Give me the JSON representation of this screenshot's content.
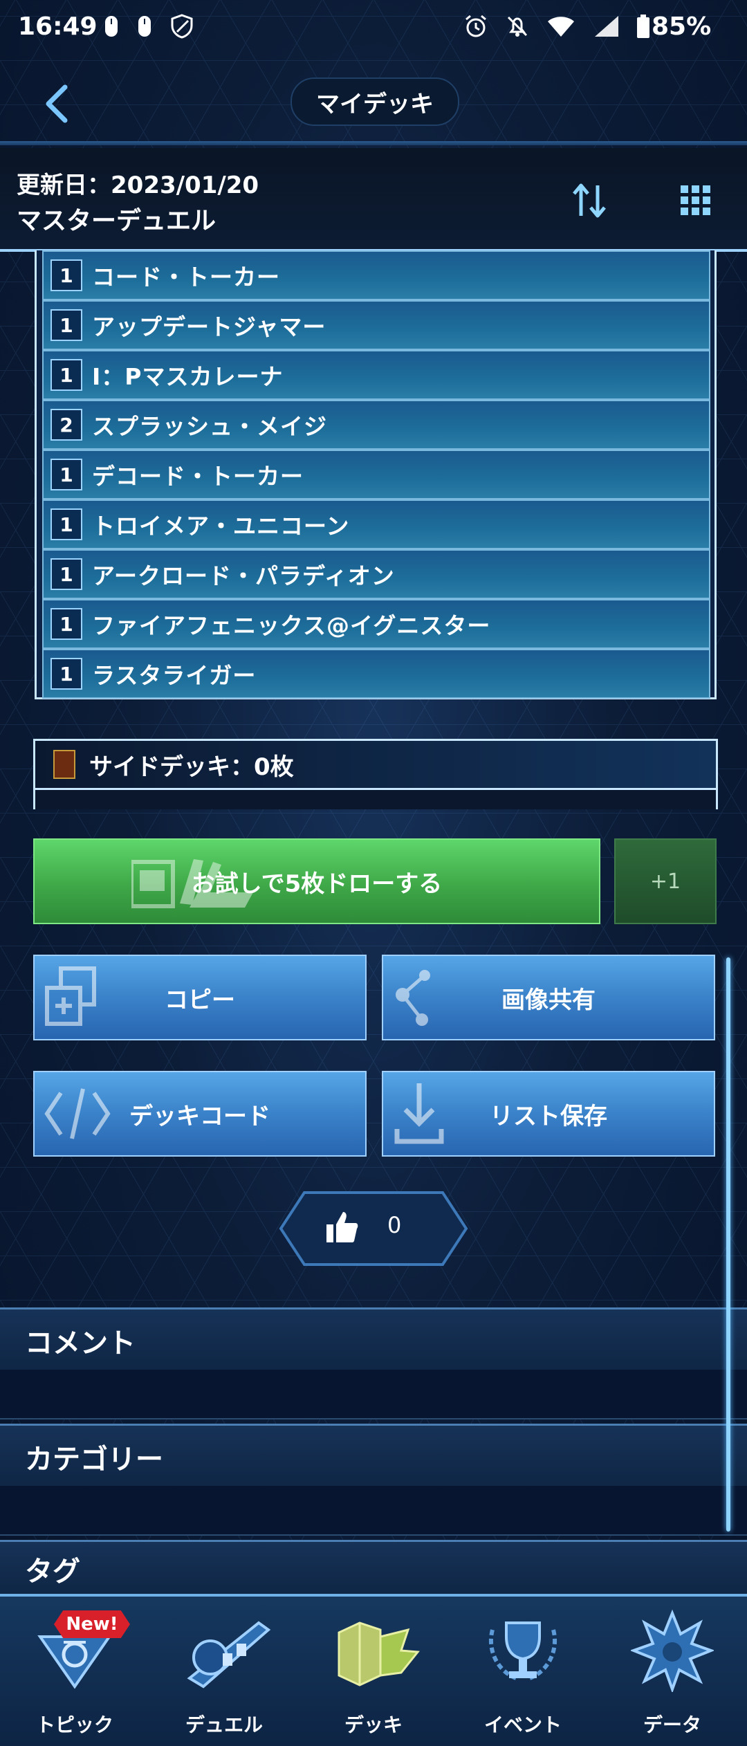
{
  "status_bar": {
    "time": "16:49",
    "battery_percent": "85%",
    "network_label": "5"
  },
  "header": {
    "title": "マイデッキ"
  },
  "deck_info": {
    "updated": "更新日：2023/01/20",
    "deck_name": "マスターデュエル"
  },
  "card_list": [
    {
      "qty": "1",
      "name": "コード・トーカー"
    },
    {
      "qty": "1",
      "name": "アップデートジャマー"
    },
    {
      "qty": "1",
      "name": "I：Pマスカレーナ"
    },
    {
      "qty": "2",
      "name": "スプラッシュ・メイジ"
    },
    {
      "qty": "1",
      "name": "デコード・トーカー"
    },
    {
      "qty": "1",
      "name": "トロイメア・ユニコーン"
    },
    {
      "qty": "1",
      "name": "アークロード・パラディオン"
    },
    {
      "qty": "1",
      "name": "ファイアフェニックス@イグニスター"
    },
    {
      "qty": "1",
      "name": "ラスタライガー"
    }
  ],
  "side_deck": {
    "label": "サイドデッキ：0枚"
  },
  "actions": {
    "draw_label": "お試しで5枚ドローする",
    "plus_one": "+1",
    "copy": "コピー",
    "share_image": "画像共有",
    "deck_code": "デッキコード",
    "save_list": "リスト保存"
  },
  "like": {
    "count": "0"
  },
  "sections": {
    "comment": "コメント",
    "category": "カテゴリー",
    "tag": "タグ"
  },
  "nav": {
    "items": [
      {
        "label": "トピック"
      },
      {
        "label": "デュエル"
      },
      {
        "label": "デッキ"
      },
      {
        "label": "イベント"
      },
      {
        "label": "データ"
      }
    ],
    "new_badge": "New!"
  },
  "colors": {
    "draw_green": "#3fa848",
    "action_blue": "#3a82c9",
    "nav_bg": "#16385f"
  }
}
